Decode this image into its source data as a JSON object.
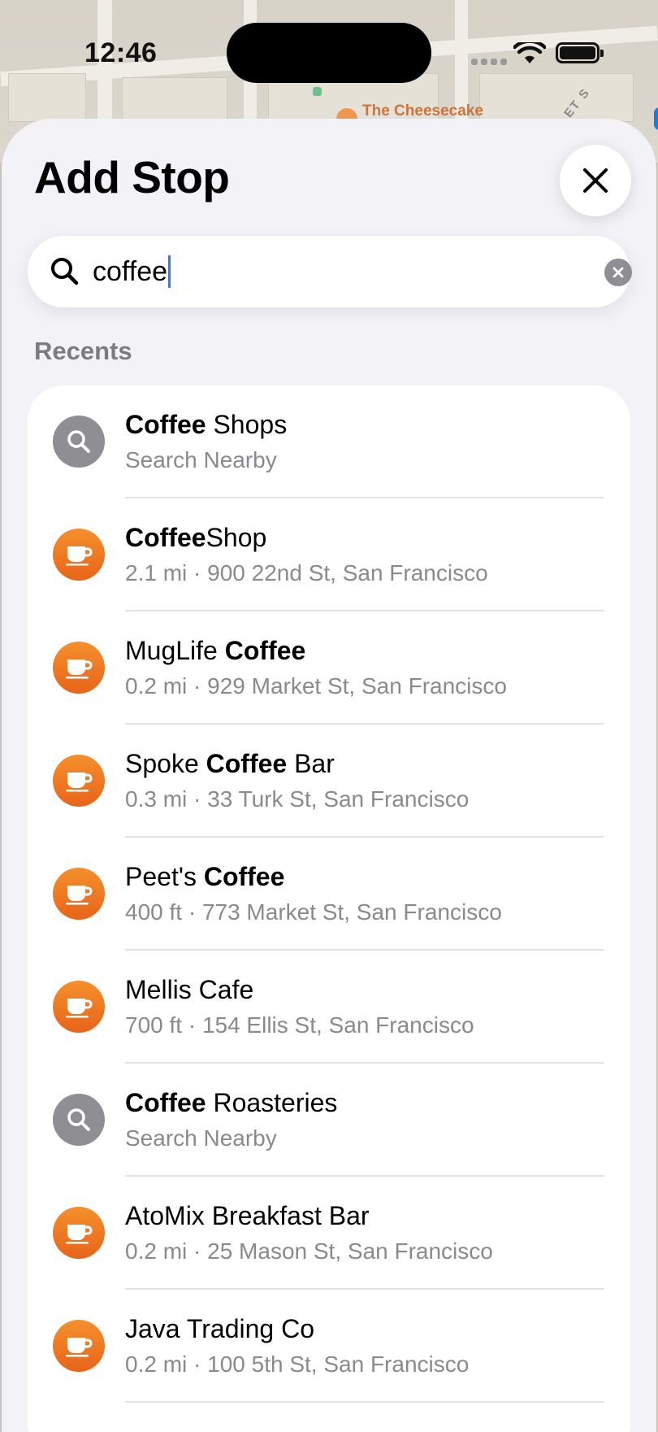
{
  "status_bar": {
    "time": "12:46"
  },
  "map": {
    "poi_label": "The Cheesecake",
    "street_label": "ET S"
  },
  "sheet": {
    "title": "Add Stop",
    "search": {
      "query": "coffee"
    },
    "section_label": "Recents",
    "results": [
      {
        "icon": "search-icon",
        "name_bold": "Coffee",
        "name_rest": " Shops",
        "name_pre": "",
        "subtitle": "Search Nearby"
      },
      {
        "icon": "coffee-cup-icon",
        "name_pre": "",
        "name_bold": "Coffee",
        "name_rest": "Shop",
        "subtitle": "2.1 mi · 900 22nd St, San Francisco"
      },
      {
        "icon": "coffee-cup-icon",
        "name_pre": "MugLife ",
        "name_bold": "Coffee",
        "name_rest": "",
        "subtitle": "0.2 mi · 929 Market St, San Francisco"
      },
      {
        "icon": "coffee-cup-icon",
        "name_pre": "Spoke ",
        "name_bold": "Coffee",
        "name_rest": " Bar",
        "subtitle": "0.3 mi · 33 Turk St, San Francisco"
      },
      {
        "icon": "coffee-cup-icon",
        "name_pre": "Peet's ",
        "name_bold": "Coffee",
        "name_rest": "",
        "subtitle": "400 ft · 773 Market St, San Francisco"
      },
      {
        "icon": "coffee-cup-icon",
        "name_pre": "Mellis Cafe",
        "name_bold": "",
        "name_rest": "",
        "subtitle": "700 ft · 154 Ellis St, San Francisco"
      },
      {
        "icon": "search-icon",
        "name_pre": "",
        "name_bold": "Coffee",
        "name_rest": " Roasteries",
        "subtitle": "Search Nearby"
      },
      {
        "icon": "coffee-cup-icon",
        "name_pre": "AtoMix Breakfast Bar",
        "name_bold": "",
        "name_rest": "",
        "subtitle": "0.2 mi · 25 Mason St, San Francisco"
      },
      {
        "icon": "coffee-cup-icon",
        "name_pre": "Java Trading Co",
        "name_bold": "",
        "name_rest": "",
        "subtitle": "0.2 mi · 100 5th St, San Francisco"
      }
    ]
  },
  "colors": {
    "accent_orange": "#f08a2c",
    "search_gray": "#8e8e93",
    "caret_blue": "#3478f6"
  }
}
